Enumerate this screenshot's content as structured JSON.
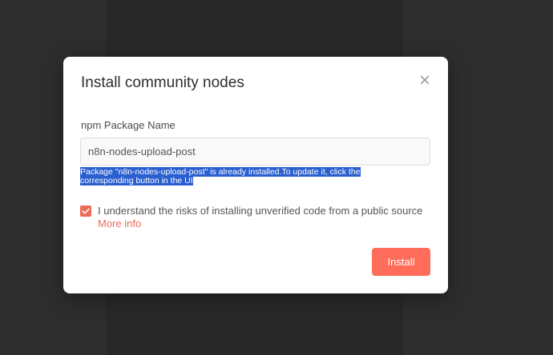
{
  "modal": {
    "title": "Install community nodes",
    "close_icon": "close-icon"
  },
  "package_field": {
    "label": "npm Package Name",
    "value": "n8n-nodes-upload-post"
  },
  "notice": {
    "text": "Package \"n8n-nodes-upload-post\" is already installed.To update it, click the corresponding button in the UI"
  },
  "consent": {
    "checked": true,
    "text": "I understand the risks of installing unverified code from a public source",
    "more_info": "More info"
  },
  "actions": {
    "install_label": "Install"
  },
  "colors": {
    "accent": "#ff6d5a",
    "selection": "#2a5fd0",
    "backdrop": "#2b2b2b"
  }
}
